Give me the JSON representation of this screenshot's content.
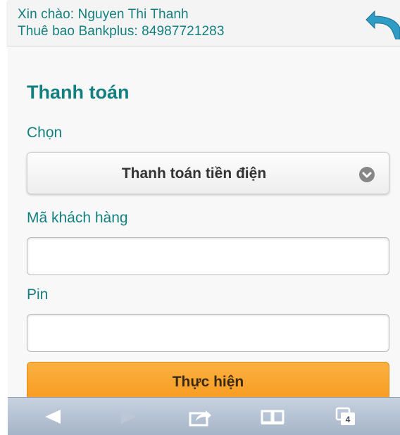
{
  "header": {
    "greeting": "Xin chào: Nguyen Thi Thanh",
    "subscriber": "Thuê bao Bankplus: 84987721283",
    "back_icon": "back-arrow-icon",
    "accent_color": "#147f7f"
  },
  "form": {
    "title": "Thanh toán",
    "select_label": "Chọn",
    "select_value": "Thanh toán tiền điện",
    "customer_code_label": "Mã khách hàng",
    "customer_code_value": "",
    "pin_label": "Pin",
    "pin_value": "",
    "submit_label": "Thực hiện",
    "submit_color": "#f7a22b"
  },
  "toolbar": {
    "items": [
      "back-icon",
      "forward-icon",
      "share-icon",
      "bookmarks-icon",
      "tabs-icon"
    ],
    "tab_count": "4"
  }
}
